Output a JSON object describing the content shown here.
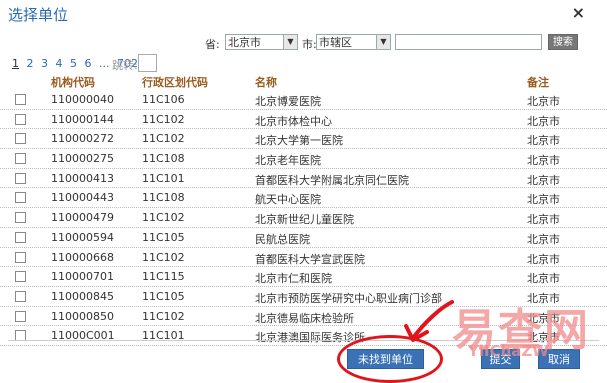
{
  "dialog": {
    "title": "选择单位",
    "close_symbol": "×"
  },
  "filters": {
    "province_label": "省:",
    "province_value": "北京市",
    "city_label": "市:",
    "city_value": "市辖区",
    "search_value": "",
    "search_button": "搜索",
    "dropdown_arrow": "▼"
  },
  "pagination": {
    "pages": [
      "1",
      "2",
      "3",
      "4",
      "5",
      "6",
      "...",
      "702"
    ],
    "current": "1",
    "jump_label": "跳转:"
  },
  "table": {
    "columns": {
      "code": "机构代码",
      "region": "行政区划代码",
      "name": "名称",
      "note": "备注"
    },
    "rows": [
      {
        "code": "110000040",
        "region": "11C106",
        "name": "北京博爱医院",
        "note": "北京市"
      },
      {
        "code": "110000144",
        "region": "11C102",
        "name": "北京市体检中心",
        "note": "北京市"
      },
      {
        "code": "110000272",
        "region": "11C102",
        "name": "北京大学第一医院",
        "note": "北京市"
      },
      {
        "code": "110000275",
        "region": "11C108",
        "name": "北京老年医院",
        "note": "北京市"
      },
      {
        "code": "110000413",
        "region": "11C101",
        "name": "首都医科大学附属北京同仁医院",
        "note": "北京市"
      },
      {
        "code": "110000443",
        "region": "11C108",
        "name": "航天中心医院",
        "note": "北京市"
      },
      {
        "code": "110000479",
        "region": "11C102",
        "name": "北京新世纪儿童医院",
        "note": "北京市"
      },
      {
        "code": "110000594",
        "region": "11C105",
        "name": "民航总医院",
        "note": "北京市"
      },
      {
        "code": "110000668",
        "region": "11C102",
        "name": "首都医科大学宣武医院",
        "note": "北京市"
      },
      {
        "code": "110000701",
        "region": "11C115",
        "name": "北京市仁和医院",
        "note": "北京市"
      },
      {
        "code": "110000845",
        "region": "11C105",
        "name": "北京市预防医学研究中心职业病门诊部",
        "note": "北京市"
      },
      {
        "code": "110000850",
        "region": "11C102",
        "name": "北京德易临床检验所",
        "note": "北京市"
      },
      {
        "code": "11000C001",
        "region": "11C101",
        "name": "北京港澳国际医务诊所",
        "note": "北京市"
      }
    ]
  },
  "footer": {
    "not_found_button": "未找到单位",
    "submit_button": "提交",
    "cancel_button": "取消"
  },
  "watermark": {
    "main": "易查网",
    "sub": "YiIChaZW"
  },
  "colors": {
    "title": "#2a6ab3",
    "header": "#9a5b1e",
    "button": "#3b72b5",
    "annotation": "#e1141c"
  }
}
